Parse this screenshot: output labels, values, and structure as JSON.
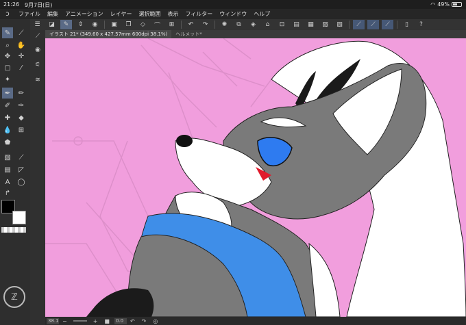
{
  "status_bar": {
    "time": "21:26",
    "date": "9月7日(日)",
    "battery": "49%",
    "battery_level": 0.49
  },
  "menu": {
    "items": [
      "ファイル",
      "編集",
      "アニメーション",
      "レイヤー",
      "選択範囲",
      "表示",
      "フィルター",
      "ウィンドウ",
      "ヘルプ"
    ]
  },
  "tabs": [
    {
      "label": "イラスト 21* (349.60 x 427.57mm 600dpi 38.1%)"
    },
    {
      "label": "ヘルメット*"
    }
  ],
  "bottom_bar": {
    "zoom": "38.1",
    "angle": "0.0"
  },
  "colors": {
    "canvas_bg": "#f19edd",
    "accent": "#5a6a86",
    "main_color": "#000000",
    "sub_color": "#ffffff",
    "shirt": "#3f8ee8"
  },
  "icons": {
    "tools": [
      "brush-icon",
      "dropper-icon",
      "zoom-icon",
      "hand-icon",
      "move-icon",
      "selection-icon",
      "eyedropper-icon",
      "wand-icon",
      "pen-icon",
      "pencil-icon",
      "brush2-icon",
      "fill-icon",
      "gradient-icon",
      "text-icon",
      "ruler-icon",
      "shape-icon",
      "eraser-icon",
      "blend-icon"
    ]
  }
}
